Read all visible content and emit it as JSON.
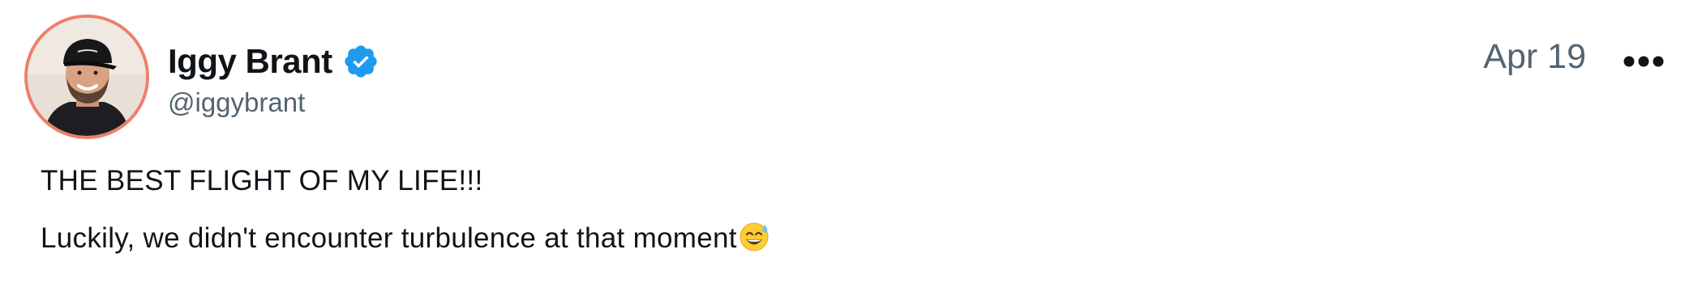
{
  "post": {
    "author": {
      "display_name": "Iggy Brant",
      "handle": "@iggybrant",
      "verified": true,
      "avatar_icon": "profile-photo"
    },
    "date": "Apr 19",
    "more_icon": "more-options-icon",
    "text": {
      "line1": "THE BEST FLIGHT OF MY LIFE!!!",
      "line2": "Luckily, we didn't encounter turbulence at that moment",
      "line2_emoji": "grinning-face-with-sweat-emoji"
    }
  },
  "colors": {
    "avatar_ring": "#ec7f6d",
    "verified_badge": "#1d9bf0",
    "secondary_text": "#536471",
    "primary_text": "#0f1419"
  }
}
